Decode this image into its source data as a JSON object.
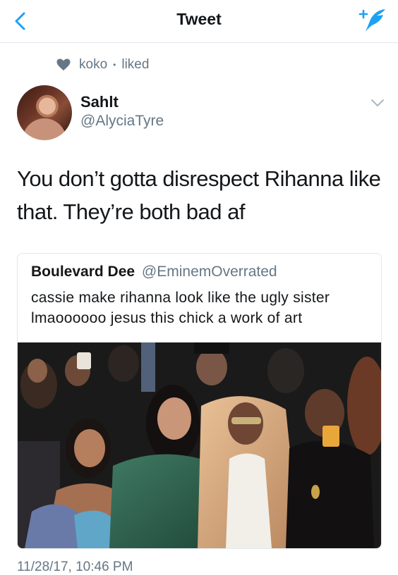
{
  "header": {
    "title": "Tweet"
  },
  "social_context": {
    "user": "koko",
    "separator": "•",
    "action": "liked"
  },
  "author": {
    "name": "Sahlt",
    "handle": "@AlyciaTyre"
  },
  "tweet": {
    "text": "You don’t gotta disrespect Rihanna like that. They’re both bad af"
  },
  "quoted": {
    "name": "Boulevard Dee",
    "handle": "@EminemOverrated",
    "text": "cassie make rihanna look like the ugly sister lmaoooooo jesus this chick a work of art"
  },
  "timestamp": "11/28/17, 10:46 PM",
  "colors": {
    "accent": "#1da1f2",
    "secondary_text": "#657786",
    "border": "#e1e8ed"
  },
  "icons": {
    "back": "chevron-left-icon",
    "compose": "compose-tweet-icon",
    "like": "heart-icon",
    "menu": "chevron-down-icon"
  }
}
